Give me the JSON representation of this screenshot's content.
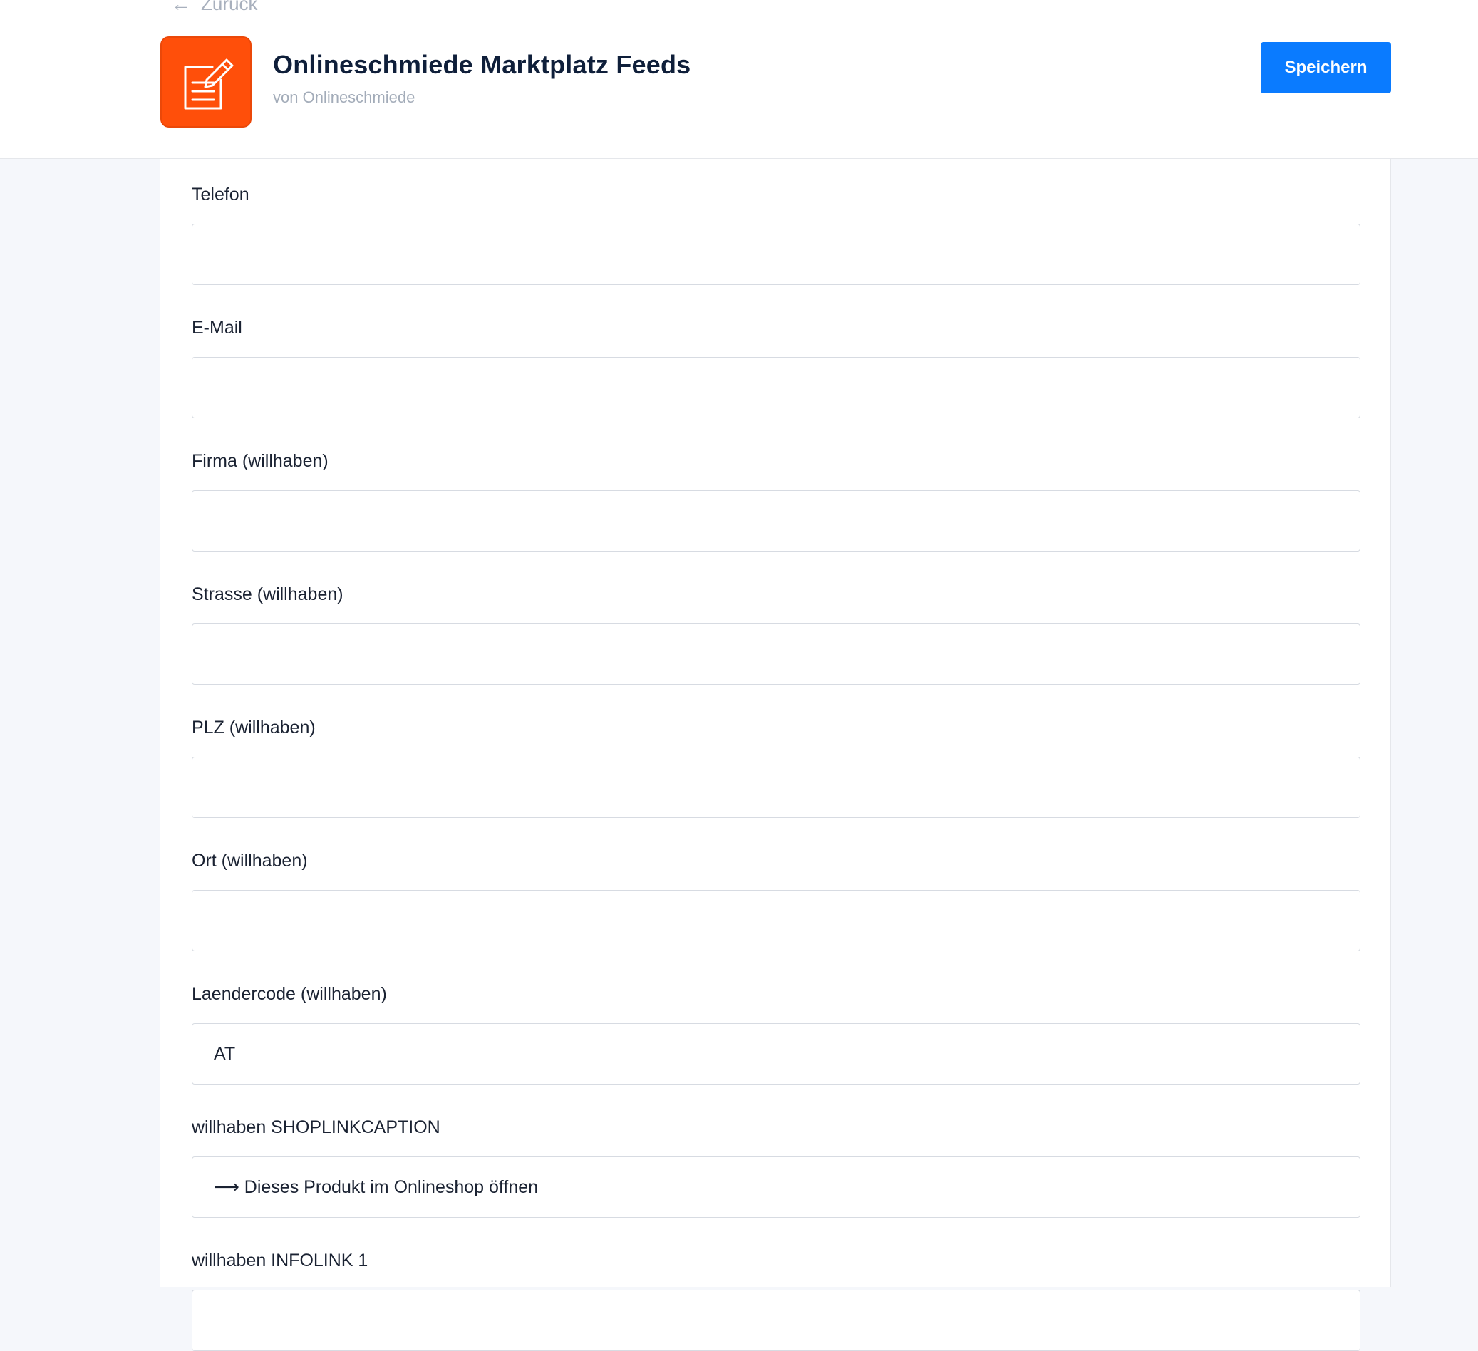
{
  "header": {
    "back_label": "Zurück",
    "back_icon": "arrow-left-icon",
    "app_icon": "edit-document-icon",
    "app_icon_color": "#ff4f0a",
    "title": "Onlineschmiede Marktplatz Feeds",
    "vendor": "von Onlineschmiede",
    "save_label": "Speichern",
    "save_color": "#0a7bff"
  },
  "form": {
    "fields": [
      {
        "label": "Telefon",
        "value": ""
      },
      {
        "label": "E-Mail",
        "value": ""
      },
      {
        "label": "Firma (willhaben)",
        "value": ""
      },
      {
        "label": "Strasse (willhaben)",
        "value": ""
      },
      {
        "label": "PLZ (willhaben)",
        "value": ""
      },
      {
        "label": "Ort (willhaben)",
        "value": ""
      },
      {
        "label": "Laendercode (willhaben)",
        "value": "AT"
      },
      {
        "label": "willhaben SHOPLINKCAPTION",
        "value": "⟶ Dieses Produkt im Onlineshop öffnen"
      },
      {
        "label": "willhaben INFOLINK 1",
        "value": ""
      }
    ]
  }
}
